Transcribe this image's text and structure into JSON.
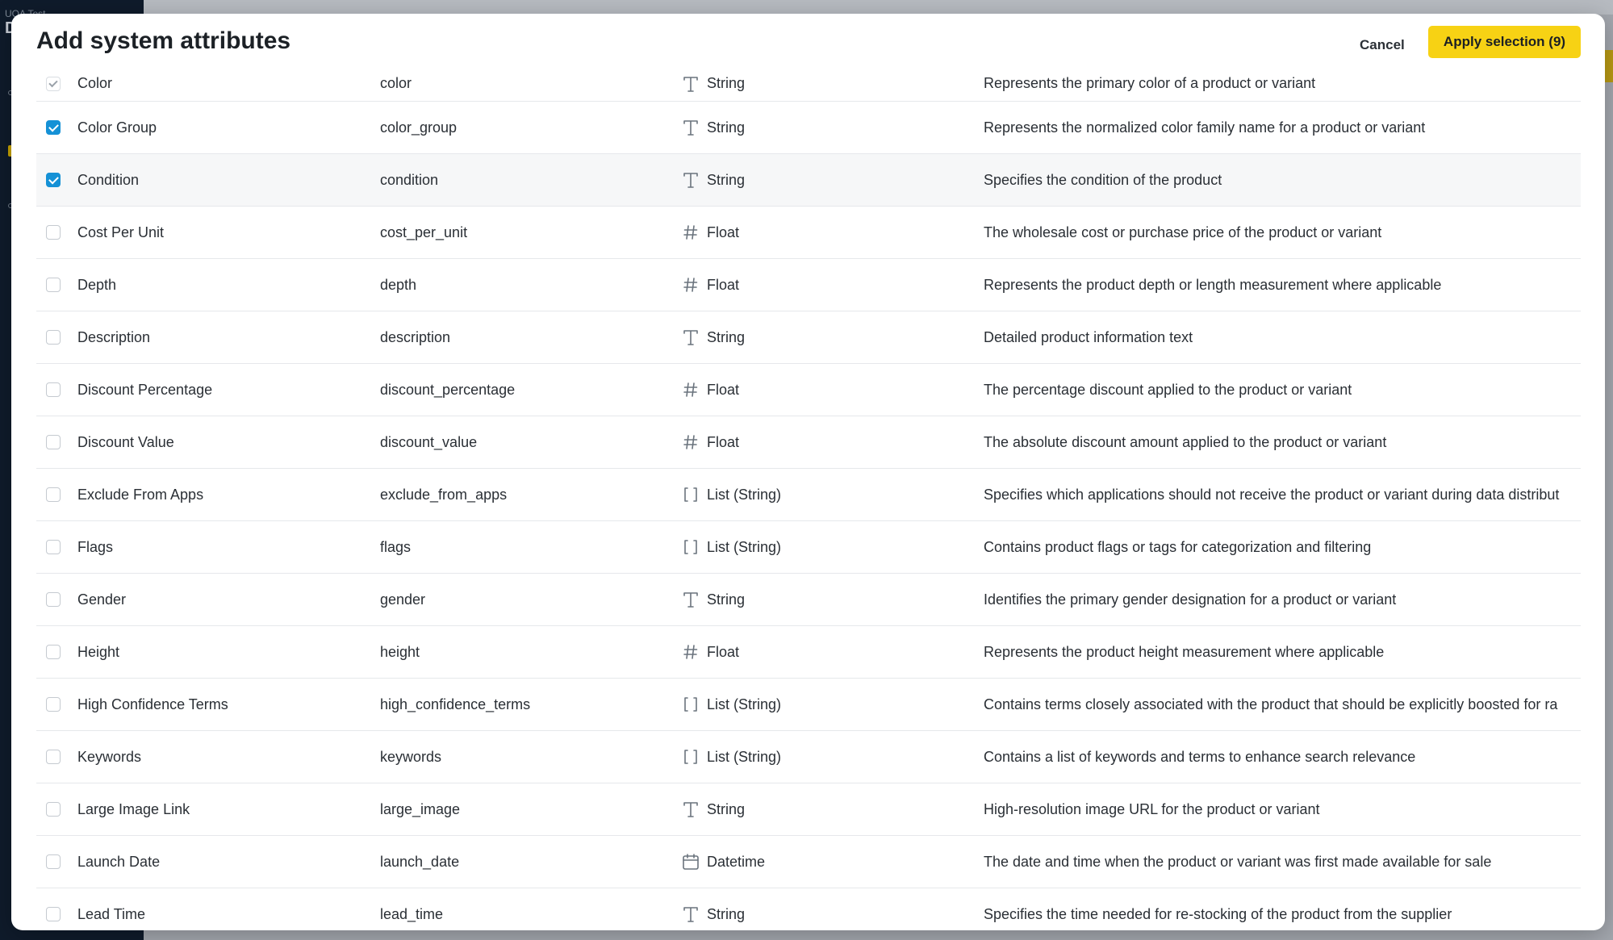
{
  "background": {
    "app_label": "UOA Test",
    "app_letter": "D"
  },
  "modal": {
    "title": "Add system attributes",
    "cancel_label": "Cancel",
    "apply_label": "Apply selection (9)"
  },
  "type_icons": {
    "String": "text-type-icon",
    "Float": "hash-icon",
    "List (String)": "brackets-icon",
    "Datetime": "calendar-icon"
  },
  "colors": {
    "accent": "#f7d214",
    "checkbox_checked": "#1591d6"
  },
  "rows": [
    {
      "name": "Color",
      "key": "color",
      "type": "String",
      "description": "Represents the primary color of a product or variant",
      "state": "locked"
    },
    {
      "name": "Color Group",
      "key": "color_group",
      "type": "String",
      "description": "Represents the normalized color family name for a product or variant",
      "state": "checked"
    },
    {
      "name": "Condition",
      "key": "condition",
      "type": "String",
      "description": "Specifies the condition of the product",
      "state": "checked"
    },
    {
      "name": "Cost Per Unit",
      "key": "cost_per_unit",
      "type": "Float",
      "description": "The wholesale cost or purchase price of the product or variant",
      "state": "unchecked"
    },
    {
      "name": "Depth",
      "key": "depth",
      "type": "Float",
      "description": "Represents the product depth or length measurement where applicable",
      "state": "unchecked"
    },
    {
      "name": "Description",
      "key": "description",
      "type": "String",
      "description": "Detailed product information text",
      "state": "unchecked"
    },
    {
      "name": "Discount Percentage",
      "key": "discount_percentage",
      "type": "Float",
      "description": "The percentage discount applied to the product or variant",
      "state": "unchecked"
    },
    {
      "name": "Discount Value",
      "key": "discount_value",
      "type": "Float",
      "description": "The absolute discount amount applied to the product or variant",
      "state": "unchecked"
    },
    {
      "name": "Exclude From Apps",
      "key": "exclude_from_apps",
      "type": "List (String)",
      "description": "Specifies which applications should not receive the product or variant during data distribut",
      "state": "unchecked"
    },
    {
      "name": "Flags",
      "key": "flags",
      "type": "List (String)",
      "description": "Contains product flags or tags for categorization and filtering",
      "state": "unchecked"
    },
    {
      "name": "Gender",
      "key": "gender",
      "type": "String",
      "description": "Identifies the primary gender designation for a product or variant",
      "state": "unchecked"
    },
    {
      "name": "Height",
      "key": "height",
      "type": "Float",
      "description": "Represents the product height measurement where applicable",
      "state": "unchecked"
    },
    {
      "name": "High Confidence Terms",
      "key": "high_confidence_terms",
      "type": "List (String)",
      "description": "Contains terms closely associated with the product that should be explicitly boosted for ra",
      "state": "unchecked"
    },
    {
      "name": "Keywords",
      "key": "keywords",
      "type": "List (String)",
      "description": "Contains a list of keywords and terms to enhance search relevance",
      "state": "unchecked"
    },
    {
      "name": "Large Image Link",
      "key": "large_image",
      "type": "String",
      "description": "High-resolution image URL for the product or variant",
      "state": "unchecked"
    },
    {
      "name": "Launch Date",
      "key": "launch_date",
      "type": "Datetime",
      "description": "The date and time when the product or variant was first made available for sale",
      "state": "unchecked"
    },
    {
      "name": "Lead Time",
      "key": "lead_time",
      "type": "String",
      "description": "Specifies the time needed for re-stocking of the product from the supplier",
      "state": "unchecked"
    }
  ]
}
